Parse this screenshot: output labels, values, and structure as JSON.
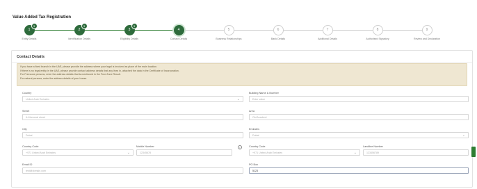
{
  "page": {
    "title": "Value Added Tax Registration"
  },
  "stepper": {
    "steps": [
      {
        "label": "Entity Details",
        "number": "1",
        "state": "done",
        "badge": "3"
      },
      {
        "label": "Identification Details",
        "number": "2",
        "state": "done",
        "badge": "3"
      },
      {
        "label": "Eligibility Details",
        "number": "3",
        "state": "done",
        "badge": "3"
      },
      {
        "label": "Contact Details",
        "number": "4",
        "state": "active",
        "badge": ""
      },
      {
        "label": "Business Relationships",
        "number": "5",
        "state": "pending",
        "badge": ""
      },
      {
        "label": "Bank Details",
        "number": "6",
        "state": "pending",
        "badge": ""
      },
      {
        "label": "Additional Details",
        "number": "7",
        "state": "pending",
        "badge": ""
      },
      {
        "label": "Authorised Signatory",
        "number": "8",
        "state": "pending",
        "badge": ""
      },
      {
        "label": "Review and Declaration",
        "number": "9",
        "state": "pending",
        "badge": ""
      }
    ]
  },
  "section": {
    "title": "Contact Details",
    "notice_lines": [
      "If you have a fixed branch in the UAE, please provide the address where your legal is involved as place of the main location.",
      "If there is no legal entity in the UAE, please provide contact address details that any lives in, attached the data in the Certificate of Incorporation.",
      "For Freezone persons, enter the address details that is mentioned in the Free Zone Result.",
      "For natural persons, enter the address details of your house."
    ]
  },
  "form": {
    "country": {
      "label": "Country",
      "value": "United Arab Emirates"
    },
    "building": {
      "label": "Building Name & Number",
      "placeholder": "Enter value"
    },
    "street": {
      "label": "Street",
      "placeholder": "A-Muroorat street"
    },
    "area": {
      "label": "Area",
      "placeholder": "Old Academi"
    },
    "city": {
      "label": "City",
      "placeholder": "Dubai"
    },
    "emirate": {
      "label": "Emirates",
      "value": "Dubai"
    },
    "country_code": {
      "label": "Country Code",
      "value": "+971 United Arab Emirates"
    },
    "mobile": {
      "label": "Mobile Number",
      "placeholder": "12345678"
    },
    "country_code2": {
      "label": "Country Code",
      "value": "+971 United Arab Emirates"
    },
    "landline": {
      "label": "Landline Number",
      "placeholder": "123456789"
    },
    "email": {
      "label": "Email ID",
      "placeholder": "test@domain.com"
    },
    "po_box": {
      "label": "PO Box",
      "value": "5123"
    }
  }
}
